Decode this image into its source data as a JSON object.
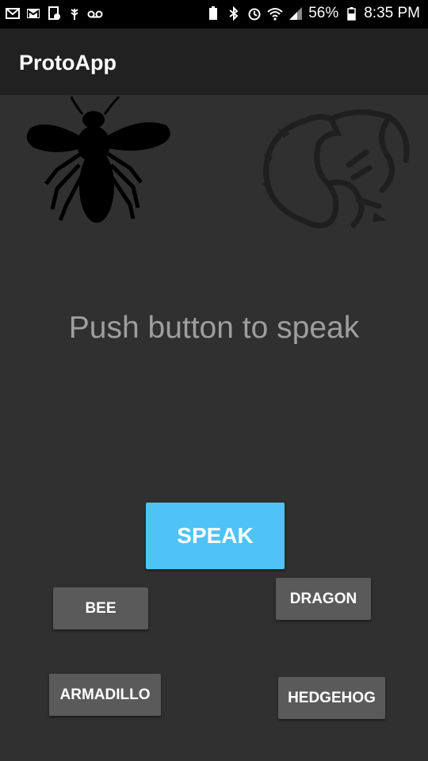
{
  "status_bar": {
    "battery": "56%",
    "time": "8:35 PM",
    "left_icons": [
      "mail-icon",
      "gmail-icon",
      "download-icon",
      "wheat-icon",
      "voicemail-icon"
    ],
    "right_icons": [
      "battery-saver-icon",
      "bluetooth-icon",
      "alarm-icon",
      "wifi-icon",
      "signal-icon",
      "battery-icon"
    ]
  },
  "app_bar": {
    "title": "ProtoApp"
  },
  "images": {
    "left": "bee-silhouette",
    "right": "dragon-tribal"
  },
  "prompt": "Push button to speak",
  "buttons": {
    "speak": "SPEAK",
    "bee": "BEE",
    "dragon": "DRAGON",
    "armadillo": "ARMADILLO",
    "hedgehog": "HEDGEHOG"
  },
  "colors": {
    "background": "#303030",
    "app_bar": "#212121",
    "accent": "#4fc3f7",
    "button": "#5a5a5a",
    "prompt_text": "#9e9e9e"
  }
}
